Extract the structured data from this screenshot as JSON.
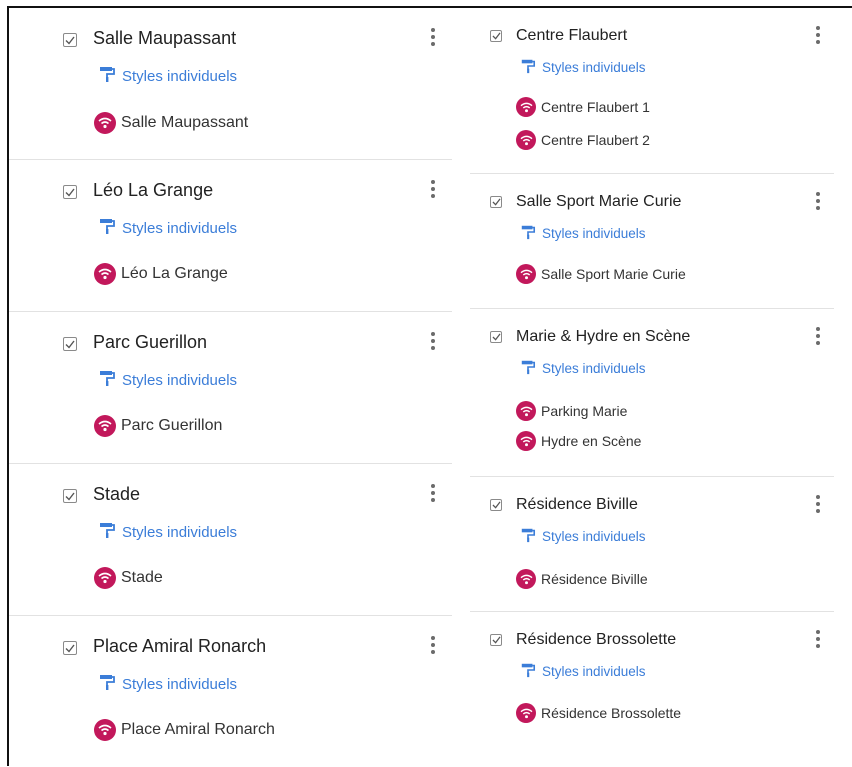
{
  "accent": "#3b7dd8",
  "pin_color": "#c2185b",
  "style_label": "Styles individuels",
  "left_layers": [
    {
      "title": "Salle Maupassant",
      "items": [
        "Salle Maupassant"
      ]
    },
    {
      "title": "Léo La Grange",
      "items": [
        "Léo La Grange"
      ]
    },
    {
      "title": "Parc Guerillon",
      "items": [
        "Parc Guerillon"
      ]
    },
    {
      "title": "Stade",
      "items": [
        "Stade"
      ]
    },
    {
      "title": "Place Amiral Ronarch",
      "items": [
        "Place Amiral Ronarch"
      ]
    }
  ],
  "right_layers": [
    {
      "title": "Centre Flaubert",
      "items": [
        "Centre Flaubert 1",
        "Centre Flaubert 2"
      ]
    },
    {
      "title": "Salle Sport Marie Curie",
      "items": [
        "Salle Sport Marie Curie"
      ]
    },
    {
      "title": "Marie & Hydre en Scène",
      "items": [
        "Parking Marie",
        "Hydre en Scène"
      ]
    },
    {
      "title": "Résidence Biville",
      "items": [
        "Résidence Biville"
      ]
    },
    {
      "title": "Résidence Brossolette",
      "items": [
        "Résidence Brossolette"
      ]
    }
  ]
}
